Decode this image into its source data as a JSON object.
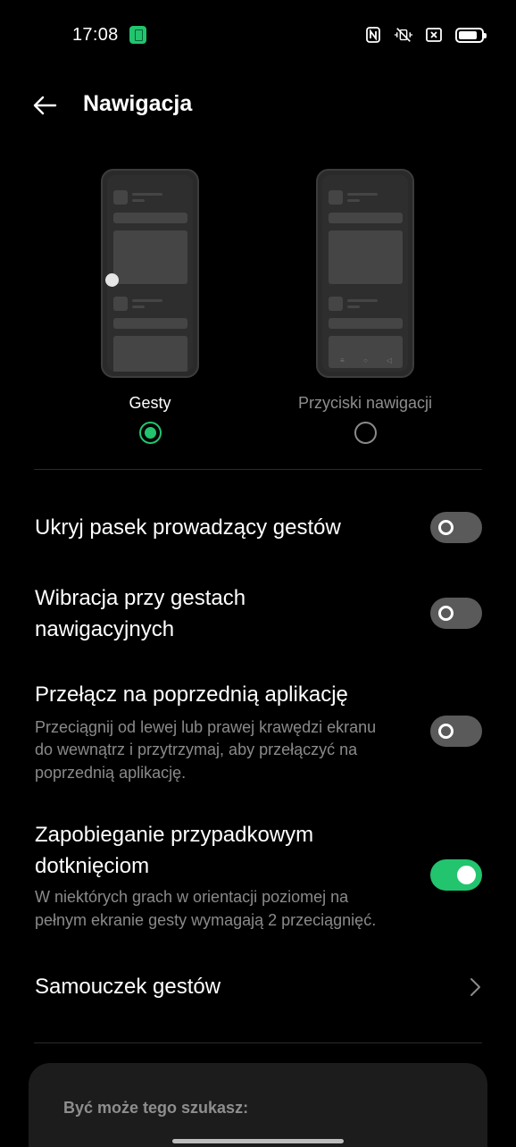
{
  "status_bar": {
    "time": "17:08",
    "icons": [
      "app-notification-icon",
      "nfc-icon",
      "vibrate-off-icon",
      "close-box-icon",
      "battery-icon"
    ],
    "battery_level": 0.72
  },
  "header": {
    "title": "Nawigacja",
    "back_icon": "arrow-left-icon"
  },
  "navigation_modes": {
    "options": [
      {
        "label": "Gesty",
        "selected": true
      },
      {
        "label": "Przyciski nawigacji",
        "selected": false
      }
    ]
  },
  "settings": [
    {
      "title": "Ukryj pasek prowadzący gestów",
      "enabled": false
    },
    {
      "title_line1": "Wibracja przy gestach",
      "title_line2": "nawigacyjnych",
      "enabled": false
    },
    {
      "title": "Przełącz na poprzednią aplikację",
      "desc_line1": "Przeciągnij od lewej lub prawej krawędzi ekranu",
      "desc_line2": "do wewnątrz i przytrzymaj, aby przełączyć na",
      "desc_line3": "poprzednią aplikację.",
      "enabled": false
    },
    {
      "title_line1": "Zapobieganie przypadkowym",
      "title_line2": "dotknięciom",
      "desc_line1": "W niektórych grach w orientacji poziomej na",
      "desc_line2": "pełnym ekranie gesty wymagają 2 przeciągnięć.",
      "enabled": true
    },
    {
      "title": "Samouczek gestów",
      "icon": "chevron-right-icon"
    }
  ],
  "suggestions": {
    "title": "Być może tego szukasz:"
  },
  "colors": {
    "accent": "#22c46e",
    "background": "#000000",
    "secondary_text": "#8a8a8a"
  }
}
